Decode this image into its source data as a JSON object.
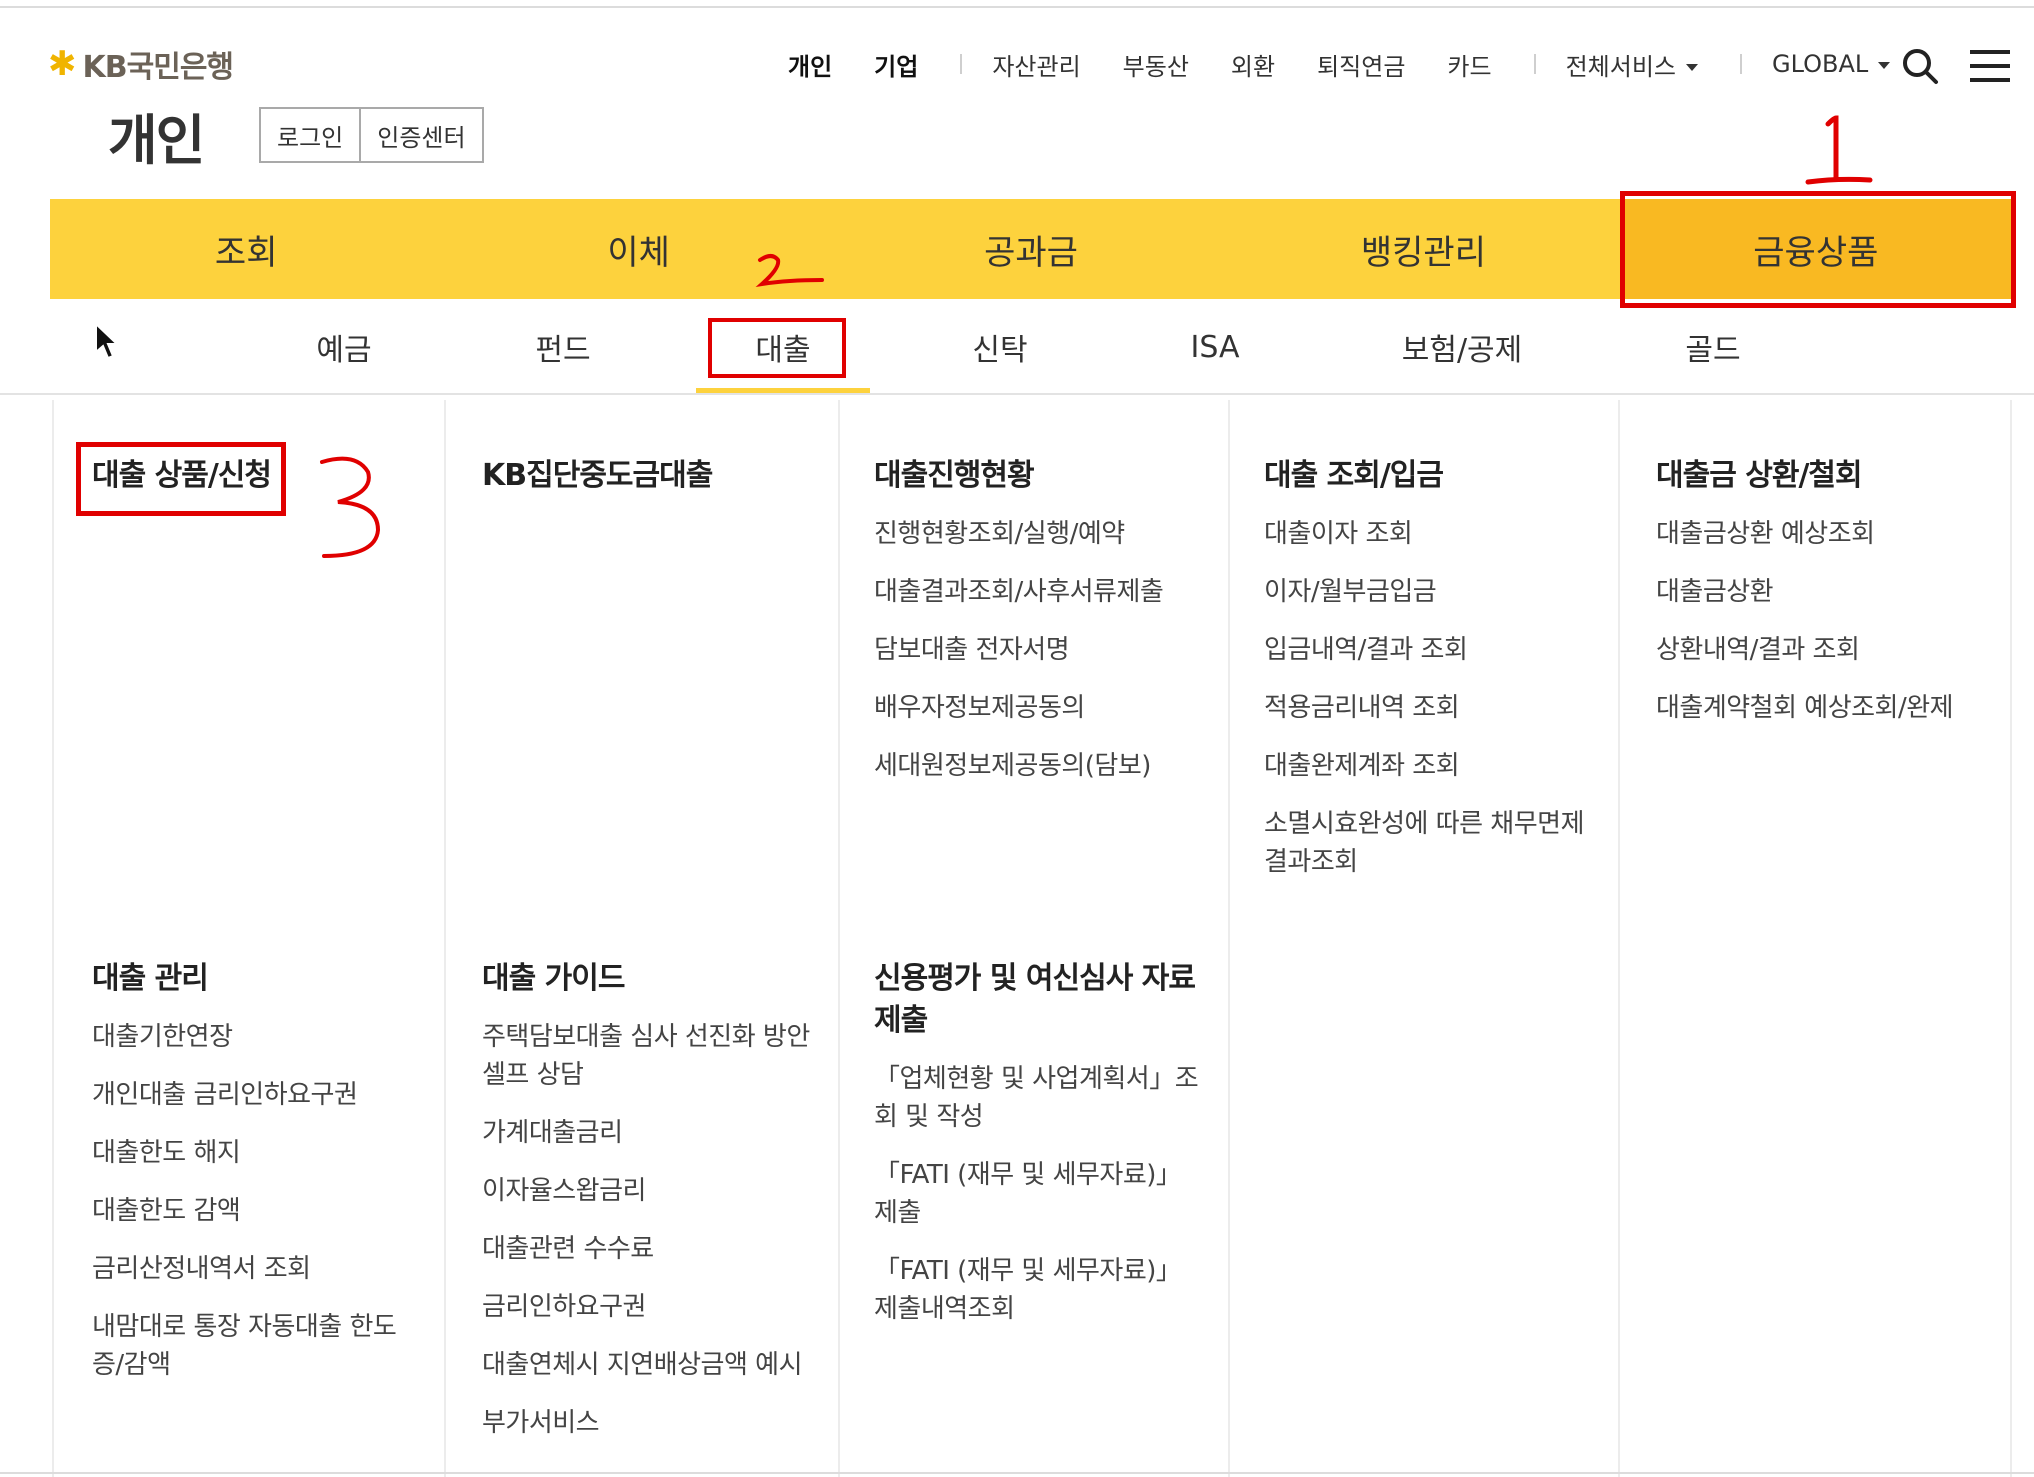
{
  "header": {
    "logo_text": "KB국민은행",
    "section_title": "개인",
    "auth": [
      "로그인",
      "인증센터"
    ]
  },
  "topnav": {
    "items": [
      "개인",
      "기업",
      "자산관리",
      "부동산",
      "외환",
      "퇴직연금",
      "카드",
      "전체서비스",
      "GLOBAL"
    ]
  },
  "mainnav": {
    "tabs": [
      "조회",
      "이체",
      "공과금",
      "뱅킹관리",
      "금융상품"
    ],
    "active": "금융상품"
  },
  "subnav": {
    "items": [
      "예금",
      "펀드",
      "대출",
      "신탁",
      "ISA",
      "보험/공제",
      "골드"
    ],
    "active": "대출"
  },
  "annotations": {
    "a1": "1",
    "a2": "2",
    "a3": "3",
    "color": "#e00000"
  },
  "menu": {
    "groups": [
      {
        "title": "대출 상품/신청",
        "items": []
      },
      {
        "title": "KB집단중도금대출",
        "items": []
      },
      {
        "title": "대출진행현황",
        "items": [
          "진행현황조회/실행/예약",
          "대출결과조회/사후서류제출",
          "담보대출 전자서명",
          "배우자정보제공동의",
          "세대원정보제공동의(담보)"
        ]
      },
      {
        "title": "대출 조회/입금",
        "items": [
          "대출이자 조회",
          "이자/월부금입금",
          "입금내역/결과 조회",
          "적용금리내역 조회",
          "대출완제계좌 조회",
          "소멸시효완성에 따른 채무면제 결과조회"
        ]
      },
      {
        "title": "대출금 상환/철회",
        "items": [
          "대출금상환 예상조회",
          "대출금상환",
          "상환내역/결과 조회",
          "대출계약철회 예상조회/완제"
        ]
      },
      {
        "title": "대출 관리",
        "items": [
          "대출기한연장",
          "개인대출 금리인하요구권",
          "대출한도 해지",
          "대출한도 감액",
          "금리산정내역서 조회",
          "내맘대로 통장 자동대출 한도 증/감액"
        ]
      },
      {
        "title": "대출 가이드",
        "items": [
          "주택담보대출 심사 선진화 방안 셀프 상담",
          "가계대출금리",
          "이자율스왑금리",
          "대출관련 수수료",
          "금리인하요구권",
          "대출연체시 지연배상금액 예시",
          "부가서비스"
        ]
      },
      {
        "title": "신용평가 및 여신심사 자료제출",
        "items": [
          "「업체현황 및 사업계획서」조회 및 작성",
          "「FATI (재무 및 세무자료)」 제출",
          "「FATI (재무 및 세무자료)」 제출내역조회"
        ]
      }
    ]
  }
}
